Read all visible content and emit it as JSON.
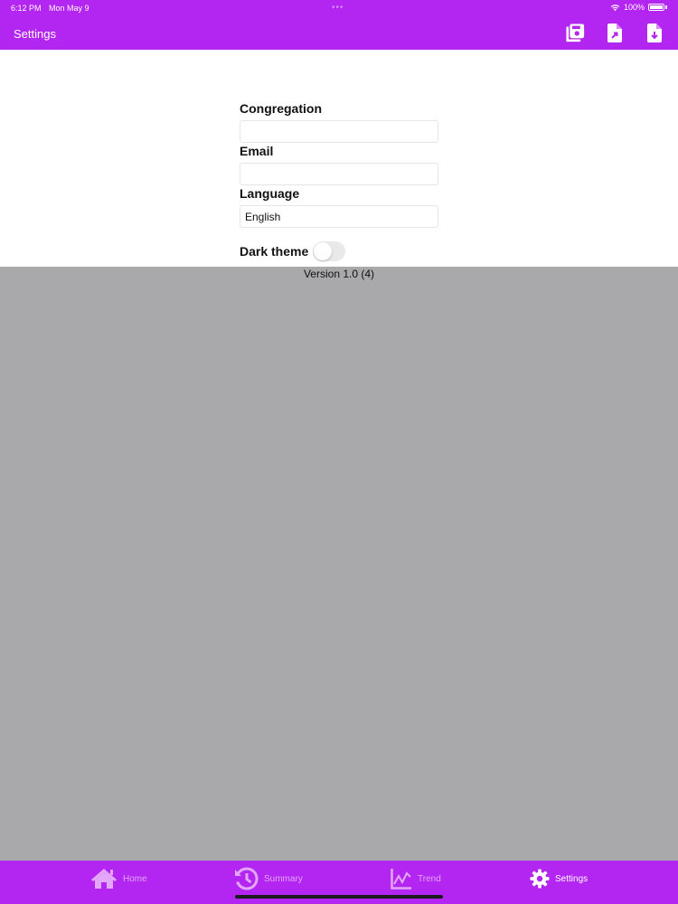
{
  "status_bar": {
    "time": "6:12 PM",
    "date": "Mon May 9",
    "battery": "100%"
  },
  "header": {
    "title": "Settings"
  },
  "form": {
    "congregation": {
      "label": "Congregation",
      "value": ""
    },
    "email": {
      "label": "Email",
      "value": ""
    },
    "language": {
      "label": "Language",
      "value": "English"
    },
    "dark_theme": {
      "label": "Dark theme",
      "on": false
    }
  },
  "version": "Version 1.0 (4)",
  "tabs": [
    {
      "label": "Home",
      "icon": "home-icon"
    },
    {
      "label": "Summary",
      "icon": "history-icon"
    },
    {
      "label": "Trend",
      "icon": "chart-line-icon"
    },
    {
      "label": "Settings",
      "icon": "gear-icon"
    }
  ],
  "colors": {
    "brand": "#b325f0",
    "background": "#a9a8ab"
  }
}
